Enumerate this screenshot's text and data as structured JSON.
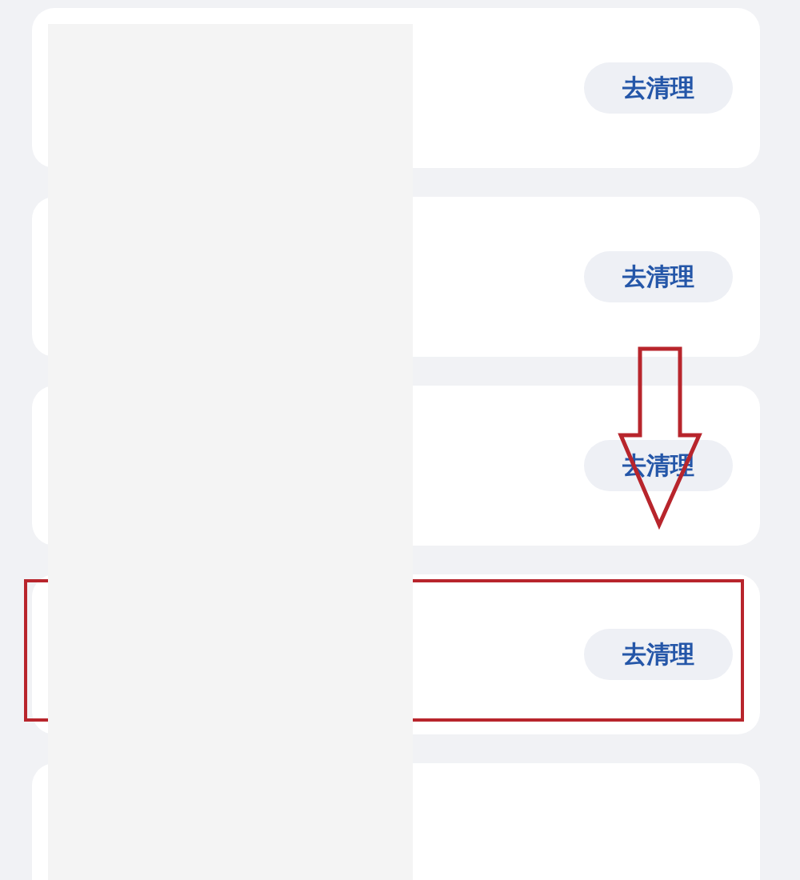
{
  "cards": [
    {
      "button": "去清理",
      "highlighted": false
    },
    {
      "button": "去清理",
      "highlighted": false
    },
    {
      "button": "去清理",
      "highlighted": false
    },
    {
      "button": "去清理",
      "highlighted": true
    },
    {
      "highlighted": false
    }
  ]
}
